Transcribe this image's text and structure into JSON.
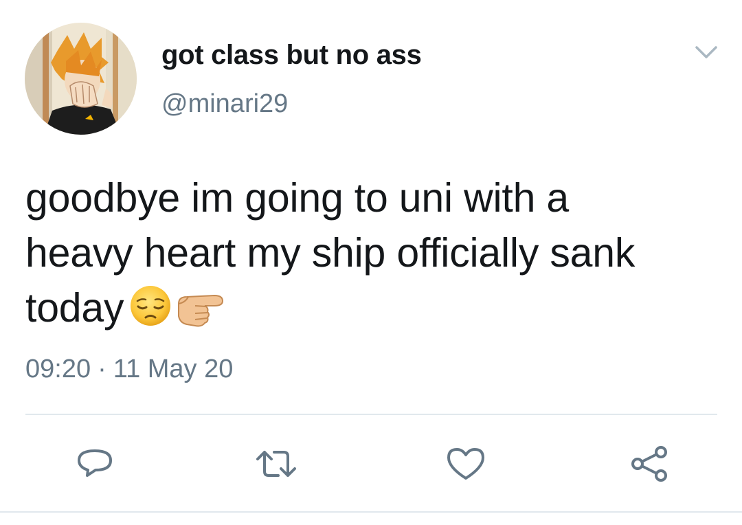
{
  "tweet": {
    "display_name": "got class but no ass",
    "handle": "@minari29",
    "text_lines": [
      "goodbye im going to uni with a",
      "heavy heart my ship officially sank",
      "today"
    ],
    "emojis": [
      "pensive-face",
      "pointing-right-hand"
    ],
    "time": "09:20",
    "date": "11 May 20",
    "separator": "·"
  },
  "icons": {
    "menu": "chevron-down-icon",
    "reply": "reply-icon",
    "retweet": "retweet-icon",
    "like": "heart-icon",
    "share": "share-icon"
  },
  "colors": {
    "text": "#14171a",
    "secondary": "#657786",
    "divider": "#e1e8ed"
  }
}
